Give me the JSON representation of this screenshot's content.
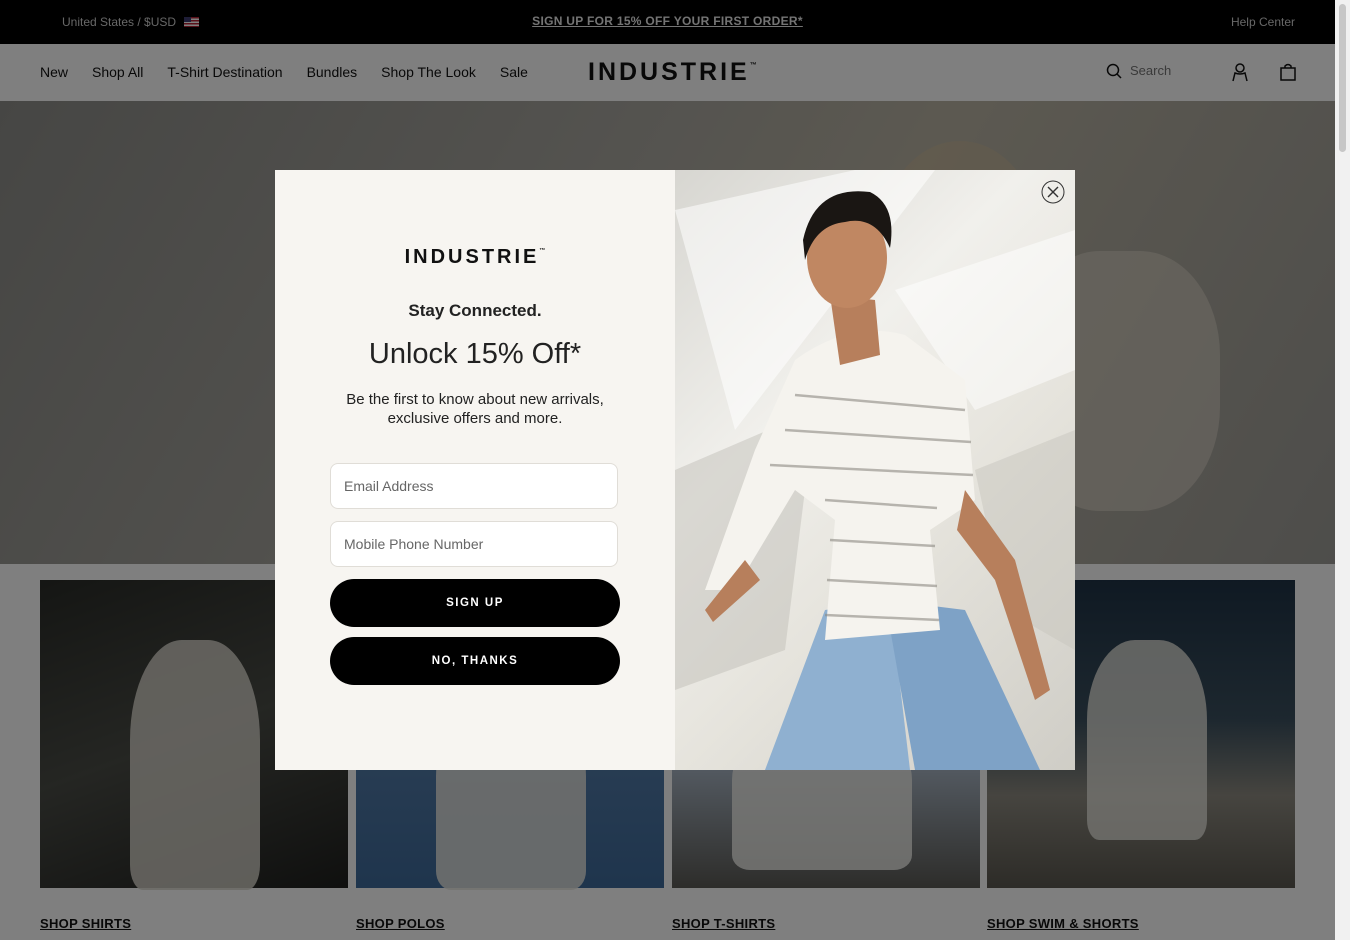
{
  "topbar": {
    "region": "United States / $USD",
    "promo": "SIGN UP FOR 15% OFF YOUR FIRST ORDER*",
    "help": "Help Center"
  },
  "nav": {
    "links": [
      "New",
      "Shop All",
      "T-Shirt Destination",
      "Bundles",
      "Shop The Look",
      "Sale"
    ],
    "logo": "INDUSTRIE",
    "search_placeholder": "Search",
    "icons": [
      "search-icon",
      "account-icon",
      "bag-icon"
    ]
  },
  "tiles": {
    "labels": [
      "SHOP SHIRTS",
      "SHOP POLOS",
      "SHOP T-SHIRTS",
      "SHOP SWIM & SHORTS"
    ]
  },
  "modal": {
    "brand": "INDUSTRIE",
    "kicker": "Stay Connected.",
    "headline": "Unlock 15% Off*",
    "body": "Be the first to know about new arrivals, exclusive offers and more.",
    "email_placeholder": "Email Address",
    "phone_placeholder": "Mobile Phone Number",
    "signup_label": "SIGN UP",
    "decline_label": "NO, THANKS",
    "close_icon": "close-icon"
  },
  "colors": {
    "topbar_bg": "#000000",
    "modal_bg": "#f7f5f1",
    "button_bg": "#000000",
    "overlay": "rgba(0,0,0,0.5)"
  }
}
